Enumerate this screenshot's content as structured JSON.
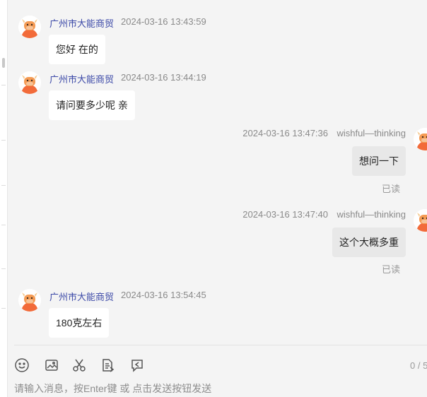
{
  "messages": [
    {
      "direction": "in",
      "sender": "广州市大能商贸",
      "time": "2024-03-16 13:43:59",
      "text": "您好 在的"
    },
    {
      "direction": "in",
      "sender": "广州市大能商贸",
      "time": "2024-03-16 13:44:19",
      "text": "请问要多少呢  亲"
    },
    {
      "direction": "out",
      "sender": "wishful—thinking",
      "time": "2024-03-16 13:47:36",
      "text": "想问一下",
      "status": "已读"
    },
    {
      "direction": "out",
      "sender": "wishful—thinking",
      "time": "2024-03-16 13:47:40",
      "text": "这个大概多重",
      "status": "已读"
    },
    {
      "direction": "in",
      "sender": "广州市大能商贸",
      "time": "2024-03-16 13:54:45",
      "text": "180克左右"
    }
  ],
  "toolbar": {
    "icons": [
      "emoji-icon",
      "image-icon",
      "scissors-icon",
      "document-icon",
      "quick-reply-icon"
    ],
    "counter": "0 / 5"
  },
  "composer": {
    "placeholder": "请输入消息，按Enter键 或 点击发送按钮发送",
    "value": ""
  },
  "colors": {
    "background": "#f4f4f4",
    "sender_name": "#3d4aa8",
    "timestamp": "#8a8a8a",
    "incoming_bubble": "#ffffff",
    "outgoing_bubble": "#e8e8e8",
    "avatar_accent": "#f26b3a"
  }
}
